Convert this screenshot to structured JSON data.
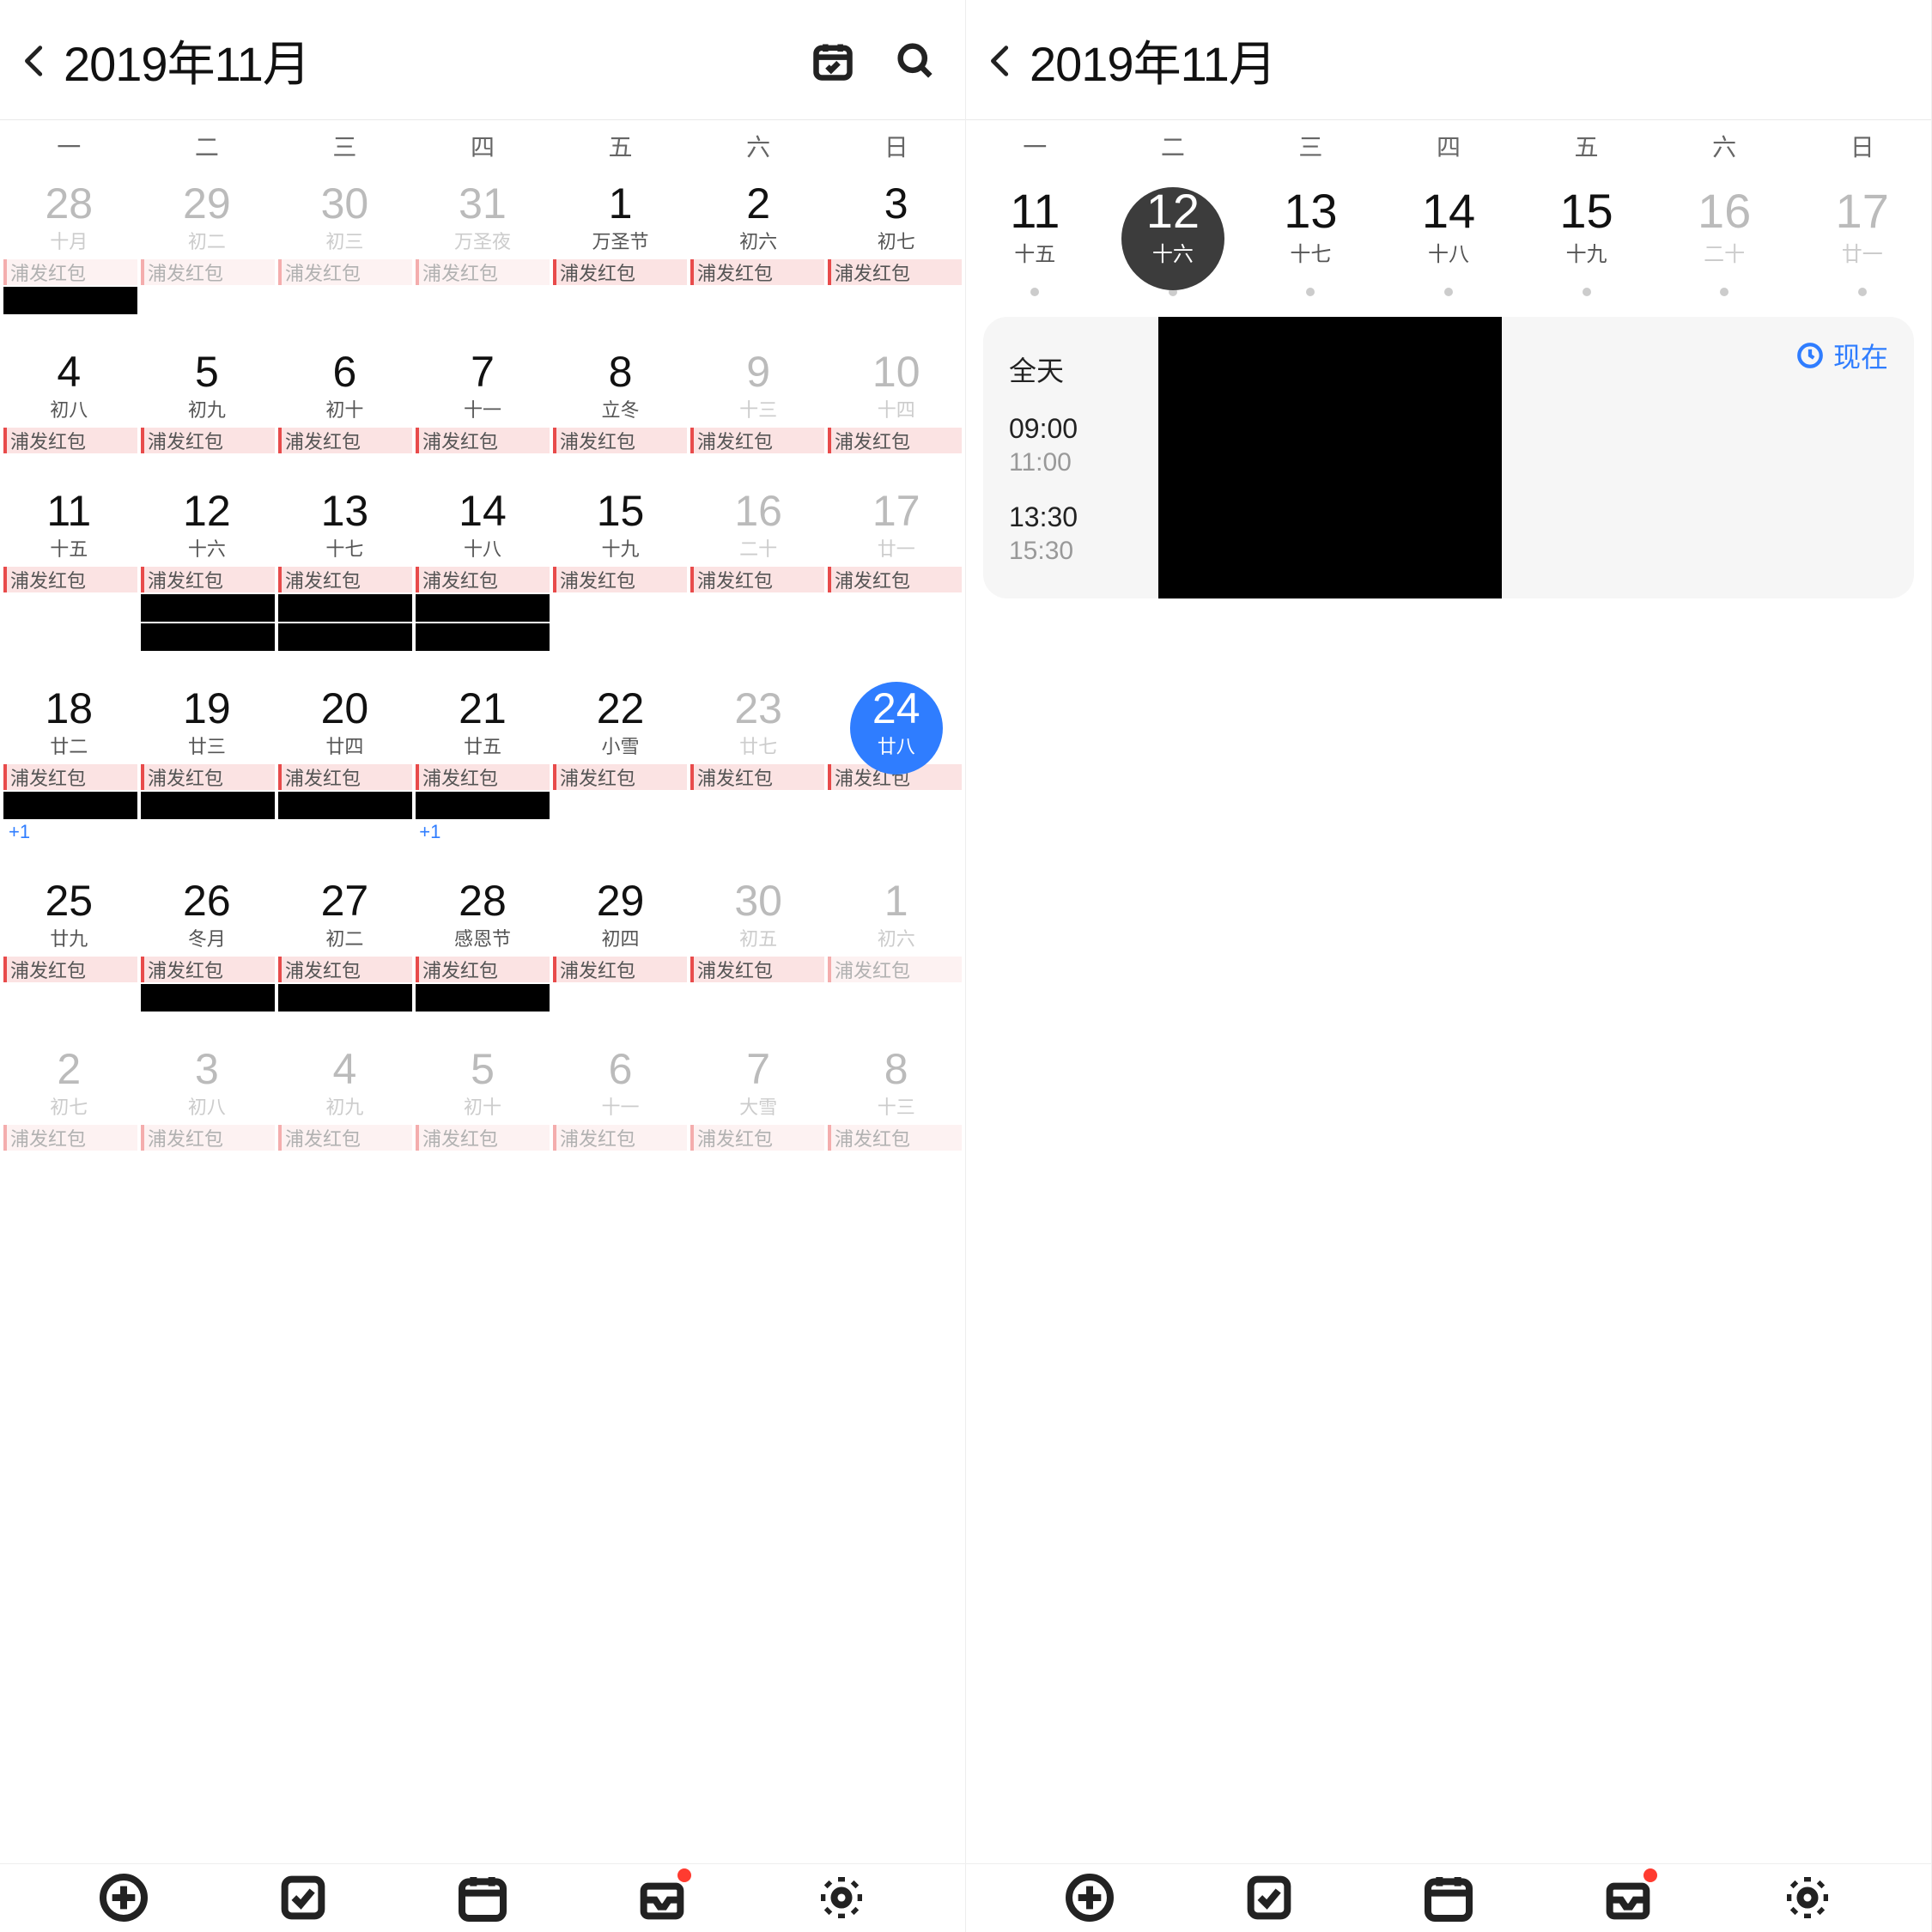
{
  "header": {
    "title": "2019年11月"
  },
  "weekdays": [
    "一",
    "二",
    "三",
    "四",
    "五",
    "六",
    "日"
  ],
  "eventChipLabel": "浦发红包",
  "plusOneLabel": "+1",
  "leftWeeks": [
    {
      "days": [
        {
          "num": "28",
          "sub": "十月",
          "dim": true
        },
        {
          "num": "29",
          "sub": "初二",
          "dim": true
        },
        {
          "num": "30",
          "sub": "初三",
          "dim": true
        },
        {
          "num": "31",
          "sub": "万圣夜",
          "dim": true
        },
        {
          "num": "1",
          "sub": "万圣节"
        },
        {
          "num": "2",
          "sub": "初六"
        },
        {
          "num": "3",
          "sub": "初七"
        }
      ],
      "chips": [
        true,
        true,
        true,
        true,
        true,
        true,
        true
      ],
      "chipDim": [
        true,
        true,
        true,
        true,
        false,
        false,
        false
      ],
      "redact": [
        true,
        false,
        false,
        false,
        false,
        false,
        false
      ]
    },
    {
      "days": [
        {
          "num": "4",
          "sub": "初八"
        },
        {
          "num": "5",
          "sub": "初九"
        },
        {
          "num": "6",
          "sub": "初十"
        },
        {
          "num": "7",
          "sub": "十一"
        },
        {
          "num": "8",
          "sub": "立冬"
        },
        {
          "num": "9",
          "sub": "十三",
          "dim": true
        },
        {
          "num": "10",
          "sub": "十四",
          "dim": true
        }
      ],
      "chips": [
        true,
        true,
        true,
        true,
        true,
        true,
        true
      ],
      "chipDim": [
        false,
        false,
        false,
        false,
        false,
        false,
        false
      ]
    },
    {
      "days": [
        {
          "num": "11",
          "sub": "十五"
        },
        {
          "num": "12",
          "sub": "十六"
        },
        {
          "num": "13",
          "sub": "十七"
        },
        {
          "num": "14",
          "sub": "十八"
        },
        {
          "num": "15",
          "sub": "十九"
        },
        {
          "num": "16",
          "sub": "二十",
          "dim": true
        },
        {
          "num": "17",
          "sub": "廿一",
          "dim": true
        }
      ],
      "chips": [
        true,
        true,
        true,
        true,
        true,
        true,
        true
      ],
      "chipDim": [
        false,
        false,
        false,
        false,
        false,
        false,
        false
      ],
      "redact": [
        false,
        true,
        true,
        true,
        false,
        false,
        false
      ],
      "redactExtra": [
        false,
        true,
        true,
        true,
        false,
        false,
        false
      ]
    },
    {
      "days": [
        {
          "num": "18",
          "sub": "廿二"
        },
        {
          "num": "19",
          "sub": "廿三"
        },
        {
          "num": "20",
          "sub": "廿四"
        },
        {
          "num": "21",
          "sub": "廿五"
        },
        {
          "num": "22",
          "sub": "小雪"
        },
        {
          "num": "23",
          "sub": "廿七",
          "dim": true
        },
        {
          "num": "24",
          "sub": "廿八",
          "selected": true
        }
      ],
      "chips": [
        true,
        true,
        true,
        true,
        true,
        true,
        true
      ],
      "chipDim": [
        false,
        false,
        false,
        false,
        false,
        false,
        false
      ],
      "redact": [
        true,
        true,
        true,
        true,
        false,
        false,
        false
      ],
      "plusOne": [
        true,
        false,
        false,
        true,
        false,
        false,
        false
      ]
    },
    {
      "days": [
        {
          "num": "25",
          "sub": "廿九"
        },
        {
          "num": "26",
          "sub": "冬月"
        },
        {
          "num": "27",
          "sub": "初二"
        },
        {
          "num": "28",
          "sub": "感恩节"
        },
        {
          "num": "29",
          "sub": "初四"
        },
        {
          "num": "30",
          "sub": "初五",
          "dim": true
        },
        {
          "num": "1",
          "sub": "初六",
          "dim": true
        }
      ],
      "chips": [
        true,
        true,
        true,
        true,
        true,
        true,
        true
      ],
      "chipDim": [
        false,
        false,
        false,
        false,
        false,
        false,
        true
      ],
      "redact": [
        false,
        true,
        true,
        true,
        false,
        false,
        false
      ]
    },
    {
      "days": [
        {
          "num": "2",
          "sub": "初七",
          "dim": true
        },
        {
          "num": "3",
          "sub": "初八",
          "dim": true
        },
        {
          "num": "4",
          "sub": "初九",
          "dim": true
        },
        {
          "num": "5",
          "sub": "初十",
          "dim": true
        },
        {
          "num": "6",
          "sub": "十一",
          "dim": true
        },
        {
          "num": "7",
          "sub": "大雪",
          "dim": true
        },
        {
          "num": "8",
          "sub": "十三",
          "dim": true
        }
      ],
      "chips": [
        true,
        true,
        true,
        true,
        true,
        true,
        true
      ],
      "chipDim": [
        true,
        true,
        true,
        true,
        true,
        true,
        true
      ]
    }
  ],
  "rightWeek": {
    "days": [
      {
        "num": "11",
        "sub": "十五"
      },
      {
        "num": "12",
        "sub": "十六",
        "selected": true
      },
      {
        "num": "13",
        "sub": "十七"
      },
      {
        "num": "14",
        "sub": "十八"
      },
      {
        "num": "15",
        "sub": "十九"
      },
      {
        "num": "16",
        "sub": "二十",
        "dim": true
      },
      {
        "num": "17",
        "sub": "廿一",
        "dim": true
      }
    ]
  },
  "agenda": {
    "allDayLabel": "全天",
    "nowLabel": "现在",
    "rows": [
      {
        "t1": "09:00",
        "t2": "11:00"
      },
      {
        "t1": "13:30",
        "t2": "15:30"
      }
    ]
  }
}
